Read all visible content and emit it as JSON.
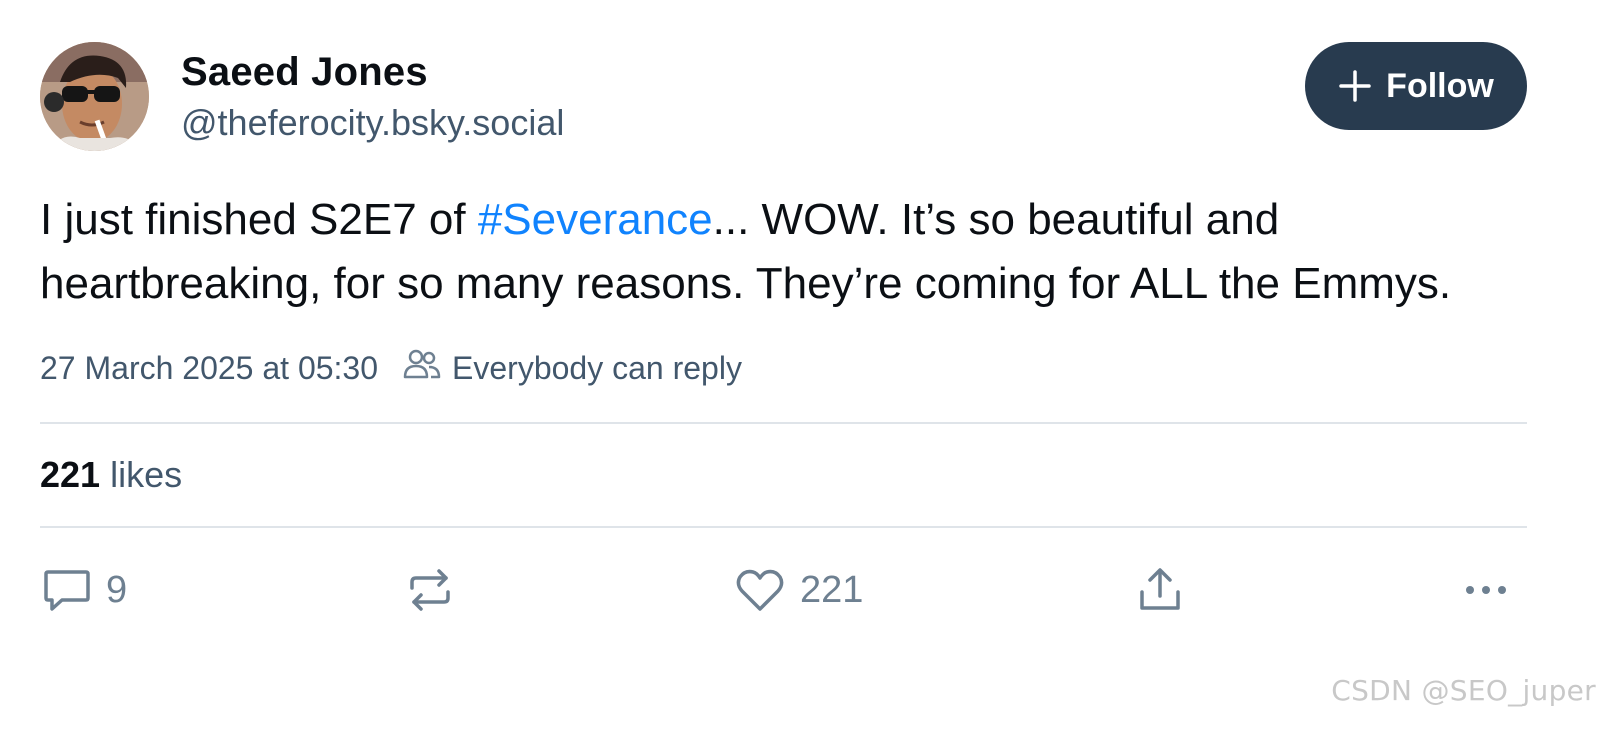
{
  "author": {
    "display_name": "Saeed Jones",
    "handle": "@theferocity.bsky.social",
    "avatar_icon": "user-avatar"
  },
  "follow_button": {
    "label": "Follow",
    "icon": "plus-icon",
    "background": "#283b4f"
  },
  "post": {
    "text_before": "I just finished S2E7 of ",
    "hashtag": "#Severance",
    "text_after": "... WOW. It’s so beautiful and heartbreaking, for so many reasons. They’re coming for ALL the Emmys.",
    "hashtag_color": "#1083fe"
  },
  "meta": {
    "timestamp": "27 March 2025 at 05:30",
    "reply_setting": "Everybody can reply",
    "reply_icon": "people-icon"
  },
  "likes": {
    "count": "221",
    "label": "likes"
  },
  "actions": {
    "reply_count": "9",
    "like_count": "221",
    "reply_icon": "comment-icon",
    "repost_icon": "repost-icon",
    "like_icon": "heart-icon",
    "share_icon": "share-icon",
    "more_icon": "more-icon"
  },
  "watermark": "CSDN @SEO_juper"
}
